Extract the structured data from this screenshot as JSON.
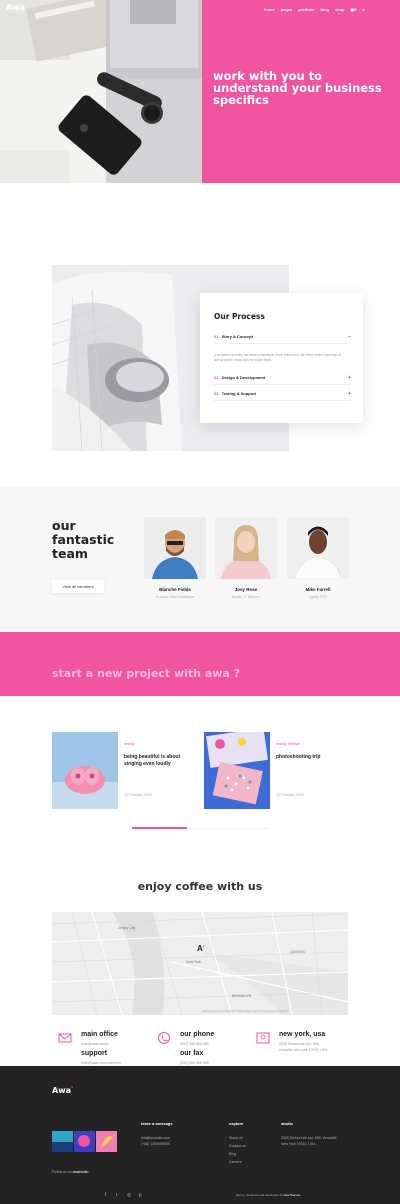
{
  "nav": {
    "logo": "Awa",
    "logo_dot": "°",
    "links": [
      "home",
      "pages",
      "portfolio",
      "blog",
      "shop"
    ],
    "cart": "0"
  },
  "hero": {
    "title": "work with you to understand your business specifics",
    "accent": "#f0559f"
  },
  "process": {
    "title": "Our Process",
    "items": [
      {
        "num": "01.",
        "label": "Story & Concept",
        "sign": "−",
        "open": true
      },
      {
        "num": "02.",
        "label": "Design & Development",
        "sign": "+",
        "open": false
      },
      {
        "num": "03.",
        "label": "Testing & Support",
        "sign": "+",
        "open": false
      }
    ],
    "description": "A wonderful serenity has taken possession of my entire soul, like these sweet mornings of spring which I enjoy with my whole heart."
  },
  "team": {
    "title_line1": "our",
    "title_line2": "fantastic",
    "title_line3": "team",
    "button": "View all members",
    "members": [
      {
        "name": "Blanche Fields",
        "role": "Account, Web Developer"
      },
      {
        "name": "Josy Rose",
        "role": "Studio, IT Director"
      },
      {
        "name": "Mike Farrell",
        "role": "Agent, CTO"
      }
    ]
  },
  "cta": {
    "text": "start a new project with awa ?"
  },
  "blog": {
    "posts": [
      {
        "category": "beauty",
        "title": "being beautiful is about singing even loudly",
        "date": "22 February 2018"
      },
      {
        "category": "beauty, lifestyle",
        "title": "photoshooting trip",
        "date": "22 February 2018"
      }
    ]
  },
  "map": {
    "heading": "enjoy coffee with us",
    "label_newyork": "New York",
    "label_jersey": "Jersey City",
    "label_brooklyn": "BROOKLYN",
    "label_queens": "QUEENS",
    "marker": "A",
    "footer_note": "Keyboard shortcuts   Map data ©2018 Google   Terms of Use   Report a map error"
  },
  "contact": {
    "office_title": "main office",
    "office_email": "hello@awa.studio",
    "office_phone_text": "(+88) 1205698909",
    "support_title": "support",
    "support_email": "hello@awa.com/volunteer",
    "phone_title": "our phone",
    "phone_value": "(562) 568 654 985",
    "fax_title": "our fax",
    "fax_value": "(562) 568 658 965",
    "addr_title": "new york, usa",
    "addr_line1": "2005 Stokes Isle Apt. 896,",
    "addr_line2": "venaville new york 10010, USA"
  },
  "footer": {
    "logo": "Awa",
    "follow": "Follow us on",
    "follow_handle": "awastudio",
    "col1_title": "leave a message",
    "col1_items": [
      "info@yoursite.com",
      "(+88) 1205698909"
    ],
    "col2_title": "explore",
    "col2_items": [
      "About us",
      "Contact us",
      "Blog",
      "Careers"
    ],
    "col3_title": "studio",
    "col3_items": [
      "2005 Stokes Isle Apt. 896, Venaville",
      "New York 10010, USA"
    ],
    "credit": "Elmoo, designed and developed by",
    "credit_by": "AweThemes",
    "social": [
      "f",
      "t",
      "◎",
      "p"
    ]
  }
}
